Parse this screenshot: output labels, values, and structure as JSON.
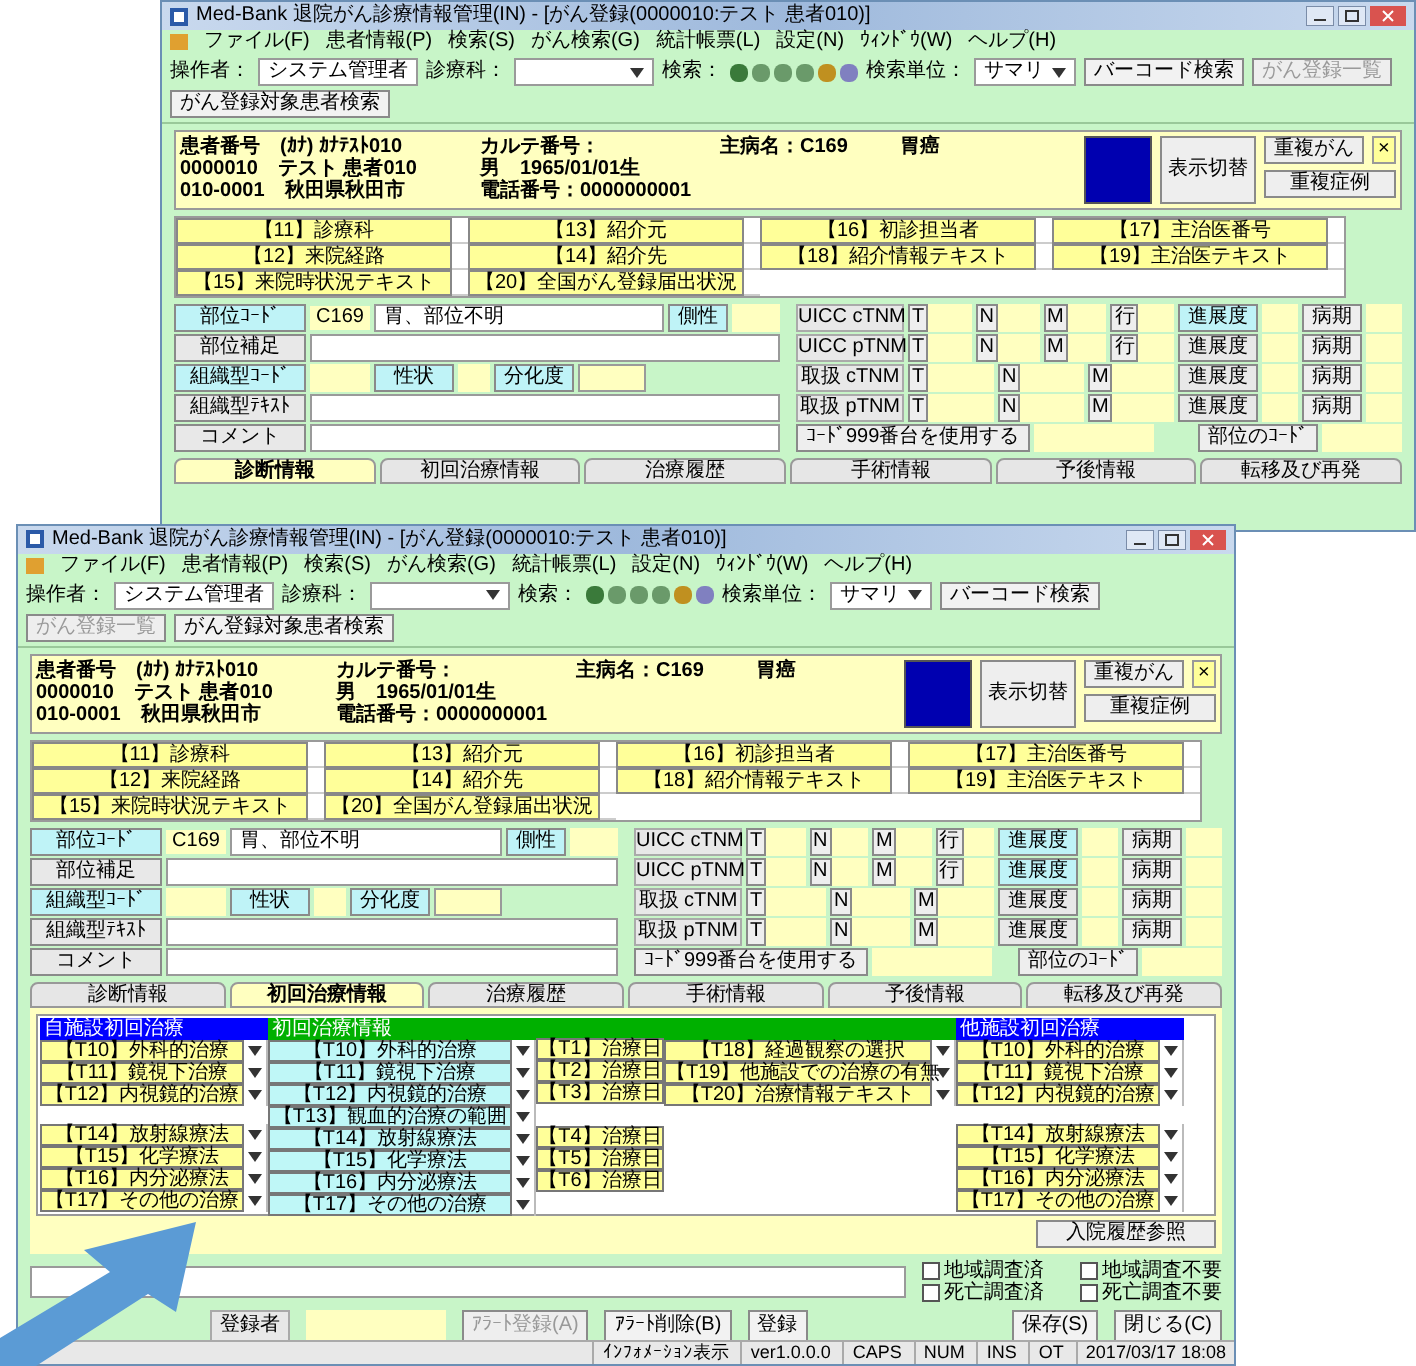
{
  "windows": [
    {
      "title": "Med-Bank 退院がん診療情報管理(IN) - [がん登録(0000010:テスト 患者010)]",
      "menu": [
        "ファイル(F)",
        "患者情報(P)",
        "検索(S)",
        "がん検索(G)",
        "統計帳票(L)",
        "設定(N)",
        "ｳｨﾝﾄﾞｳ(W)",
        "ヘルプ(H)"
      ],
      "toolbar": {
        "operator_label": "操作者：",
        "operator": "システム管理者",
        "dept_label": "診療科：",
        "search_label": "検索：",
        "unit_label": "検索単位：",
        "unit": "サマリ",
        "buttons": [
          {
            "text": "バーコード検索",
            "disabled": false
          },
          {
            "text": "がん登録一覧",
            "disabled": true
          },
          {
            "text": "がん登録対象患者検索",
            "disabled": false
          }
        ]
      },
      "patient": {
        "lines": [
          [
            "患者番号　(ｶﾅ) ｶﾅﾃｽﾄ010",
            "カルテ番号：",
            "主病名：C169",
            "胃癌"
          ],
          [
            "0000010　テスト 患者010",
            "男　1965/01/01生"
          ],
          [
            "010-0001　秋田県秋田市",
            "電話番号：0000000001"
          ]
        ],
        "switch": "表示切替",
        "duplicate": "重複がん",
        "close": "×",
        "cases": "重複症例"
      },
      "info_rows": [
        [
          "【11】診療科",
          "【13】紹介元",
          "【16】初診担当者",
          "【17】主治医番号"
        ],
        [
          "【12】来院経路",
          "【14】紹介先",
          "【18】紹介情報テキスト",
          "【19】主治医テキスト"
        ],
        [
          "【15】来院時状況テキスト",
          "【20】全国がん登録届出状況"
        ]
      ],
      "form": {
        "left": [
          {
            "kind": "site",
            "button": "部位ｺｰﾄﾞ",
            "highlighted": true,
            "code": "C169",
            "value": "胃、部位不明",
            "extra": "側性"
          },
          {
            "kind": "text",
            "button": "部位補足",
            "highlighted": false
          },
          {
            "kind": "histology",
            "button": "組織型ｺｰﾄﾞ",
            "highlighted": true,
            "middle": "性状",
            "extra": "分化度"
          },
          {
            "kind": "text",
            "button": "組織型ﾃｷｽﾄ",
            "highlighted": false
          },
          {
            "kind": "text",
            "button": "コメント",
            "highlighted": false
          }
        ],
        "right": [
          {
            "kind": "tnm",
            "label": "UICC cTNM",
            "parts": [
              "T",
              "N",
              "M",
              "行"
            ],
            "stage": "進展度",
            "stage_highlighted": true,
            "stage2": "病期"
          },
          {
            "kind": "tnm",
            "label": "UICC pTNM",
            "parts": [
              "T",
              "N",
              "M",
              "行"
            ],
            "stage": "進展度",
            "stage_highlighted": false,
            "stage2": "病期"
          },
          {
            "kind": "tnm",
            "label": "取扱 cTNM",
            "parts": [
              "T",
              "N",
              "M"
            ],
            "stage": "進展度",
            "stage_highlighted": false,
            "stage2": "病期"
          },
          {
            "kind": "tnm",
            "label": "取扱 pTNM",
            "parts": [
              "T",
              "N",
              "M"
            ],
            "stage": "進展度",
            "stage_highlighted": false,
            "stage2": "病期"
          },
          {
            "kind": "option",
            "button": "ｺｰﾄﾞ999番台を使用する",
            "extra": "部位のｺｰﾄﾞ"
          }
        ]
      },
      "tabs": [
        {
          "label": "診断情報",
          "selected": true
        },
        {
          "label": "初回治療情報",
          "selected": false
        },
        {
          "label": "治療履歴",
          "selected": false
        },
        {
          "label": "手術情報",
          "selected": false
        },
        {
          "label": "予後情報",
          "selected": false
        },
        {
          "label": "転移及び再発",
          "selected": false
        }
      ]
    },
    {
      "title": "Med-Bank 退院がん診療情報管理(IN) - [がん登録(0000010:テスト 患者010)]",
      "menu": [
        "ファイル(F)",
        "患者情報(P)",
        "検索(S)",
        "がん検索(G)",
        "統計帳票(L)",
        "設定(N)",
        "ｳｨﾝﾄﾞｳ(W)",
        "ヘルプ(H)"
      ],
      "toolbar": {
        "operator_label": "操作者：",
        "operator": "システム管理者",
        "dept_label": "診療科：",
        "search_label": "検索：",
        "unit_label": "検索単位：",
        "unit": "サマリ",
        "buttons": [
          {
            "text": "バーコード検索",
            "disabled": false
          },
          {
            "text": "がん登録一覧",
            "disabled": true
          },
          {
            "text": "がん登録対象患者検索",
            "disabled": false
          }
        ]
      },
      "patient": {
        "lines": [
          [
            "患者番号　(ｶﾅ) ｶﾅﾃｽﾄ010",
            "カルテ番号：",
            "主病名：C169",
            "胃癌"
          ],
          [
            "0000010　テスト 患者010",
            "男　1965/01/01生"
          ],
          [
            "010-0001　秋田県秋田市",
            "電話番号：0000000001"
          ]
        ],
        "switch": "表示切替",
        "duplicate": "重複がん",
        "close": "×",
        "cases": "重複症例"
      },
      "info_rows": [
        [
          "【11】診療科",
          "【13】紹介元",
          "【16】初診担当者",
          "【17】主治医番号"
        ],
        [
          "【12】来院経路",
          "【14】紹介先",
          "【18】紹介情報テキスト",
          "【19】主治医テキスト"
        ],
        [
          "【15】来院時状況テキスト",
          "【20】全国がん登録届出状況"
        ]
      ],
      "form": {
        "left": [
          {
            "kind": "site",
            "button": "部位ｺｰﾄﾞ",
            "highlighted": true,
            "code": "C169",
            "value": "胃、部位不明",
            "extra": "側性"
          },
          {
            "kind": "text",
            "button": "部位補足",
            "highlighted": false
          },
          {
            "kind": "histology",
            "button": "組織型ｺｰﾄﾞ",
            "highlighted": true,
            "middle": "性状",
            "extra": "分化度"
          },
          {
            "kind": "text",
            "button": "組織型ﾃｷｽﾄ",
            "highlighted": false
          },
          {
            "kind": "text",
            "button": "コメント",
            "highlighted": false
          }
        ],
        "right": [
          {
            "kind": "tnm",
            "label": "UICC cTNM",
            "parts": [
              "T",
              "N",
              "M",
              "行"
            ],
            "stage": "進展度",
            "stage_highlighted": true,
            "stage2": "病期"
          },
          {
            "kind": "tnm",
            "label": "UICC pTNM",
            "parts": [
              "T",
              "N",
              "M",
              "行"
            ],
            "stage": "進展度",
            "stage_highlighted": true,
            "stage2": "病期"
          },
          {
            "kind": "tnm",
            "label": "取扱 cTNM",
            "parts": [
              "T",
              "N",
              "M"
            ],
            "stage": "進展度",
            "stage_highlighted": false,
            "stage2": "病期"
          },
          {
            "kind": "tnm",
            "label": "取扱 pTNM",
            "parts": [
              "T",
              "N",
              "M"
            ],
            "stage": "進展度",
            "stage_highlighted": false,
            "stage2": "病期"
          },
          {
            "kind": "option",
            "button": "ｺｰﾄﾞ999番台を使用する",
            "extra": "部位のｺｰﾄﾞ"
          }
        ]
      },
      "tabs": [
        {
          "label": "診断情報",
          "selected": false
        },
        {
          "label": "初回治療情報",
          "selected": true
        },
        {
          "label": "治療履歴",
          "selected": false
        },
        {
          "label": "手術情報",
          "selected": false
        },
        {
          "label": "予後情報",
          "selected": false
        },
        {
          "label": "転移及び再発",
          "selected": false
        }
      ],
      "grid": {
        "columns": [
          {
            "kind": "select",
            "header": {
              "text": "自施設初回治療",
              "color": "#0000ff"
            },
            "color": "#ffff99",
            "cells": [
              {
                "label": "【T10】外科的治療"
              },
              {
                "label": "【T11】鏡視下治療"
              },
              {
                "label": "【T12】内視鏡的治療"
              },
              {},
              {
                "label": "【T14】放射線療法"
              },
              {
                "label": "【T15】化学療法"
              },
              {
                "label": "【T16】内分泌療法"
              },
              {
                "label": "【T17】その他の治療"
              }
            ]
          },
          {
            "kind": "select",
            "header": {
              "text": "初回治療情報",
              "color": "#00b000"
            },
            "color": "#bff7f7",
            "cells": [
              {
                "label": "【T10】外科的治療"
              },
              {
                "label": "【T11】鏡視下治療"
              },
              {
                "label": "【T12】内視鏡的治療"
              },
              {
                "label": "【T13】観血的治療の範囲"
              },
              {
                "label": "【T14】放射線療法"
              },
              {
                "label": "【T15】化学療法"
              },
              {
                "label": "【T16】内分泌療法"
              },
              {
                "label": "【T17】その他の治療"
              }
            ]
          },
          {
            "kind": "plain",
            "header": {
              "color": "#00b000"
            },
            "color": "#ffff99",
            "cells": [
              {
                "label": "【T1】治療日"
              },
              {
                "label": "【T2】治療日"
              },
              {
                "label": "【T3】治療日"
              },
              {},
              {
                "label": "【T4】治療日"
              },
              {
                "label": "【T5】治療日"
              },
              {
                "label": "【T6】治療日"
              },
              {}
            ]
          },
          {
            "kind": "select",
            "header": {
              "color": "#00b000"
            },
            "color": "#ffff99",
            "cells": [
              {
                "label": "【T18】経過観察の選択"
              },
              {
                "label": "【T19】他施設での治療の有無"
              },
              {
                "label": "【T20】治療情報テキスト"
              },
              {},
              {},
              {},
              {},
              {}
            ]
          },
          {
            "kind": "select",
            "header": {
              "text": "他施設初回治療",
              "color": "#0000ff"
            },
            "color": "#ffff99",
            "cells": [
              {
                "label": "【T10】外科的治療"
              },
              {
                "label": "【T11】鏡視下治療"
              },
              {
                "label": "【T12】内視鏡的治療"
              },
              {},
              {
                "label": "【T14】放射線療法"
              },
              {
                "label": "【T15】化学療法"
              },
              {
                "label": "【T16】内分泌療法"
              },
              {
                "label": "【T17】その他の治療"
              }
            ]
          }
        ]
      },
      "history_button": "入院履歴参照",
      "checks": [
        {
          "label": "地域調査済",
          "checked": false
        },
        {
          "label": "地域調査不要",
          "checked": false
        },
        {
          "label": "死亡調査済",
          "checked": false
        },
        {
          "label": "死亡調査不要",
          "checked": false
        }
      ],
      "registrar_label": "登録者",
      "buttons": [
        {
          "text": "ｱﾗｰﾄ登録(A)",
          "disabled": true
        },
        {
          "text": "ｱﾗｰﾄ削除(B)",
          "disabled": false
        },
        {
          "text": "登録",
          "disabled": false
        },
        {
          "text": "保存(S)",
          "disabled": false
        },
        {
          "text": "閉じる(C)",
          "disabled": false
        }
      ],
      "status_bar": [
        "ｲﾝﾌｫﾒｰｼｮﾝ表示",
        "ver1.0.0.0",
        "CAPS",
        "NUM",
        "INS",
        "OT",
        "2017/03/17 18:08"
      ]
    }
  ]
}
